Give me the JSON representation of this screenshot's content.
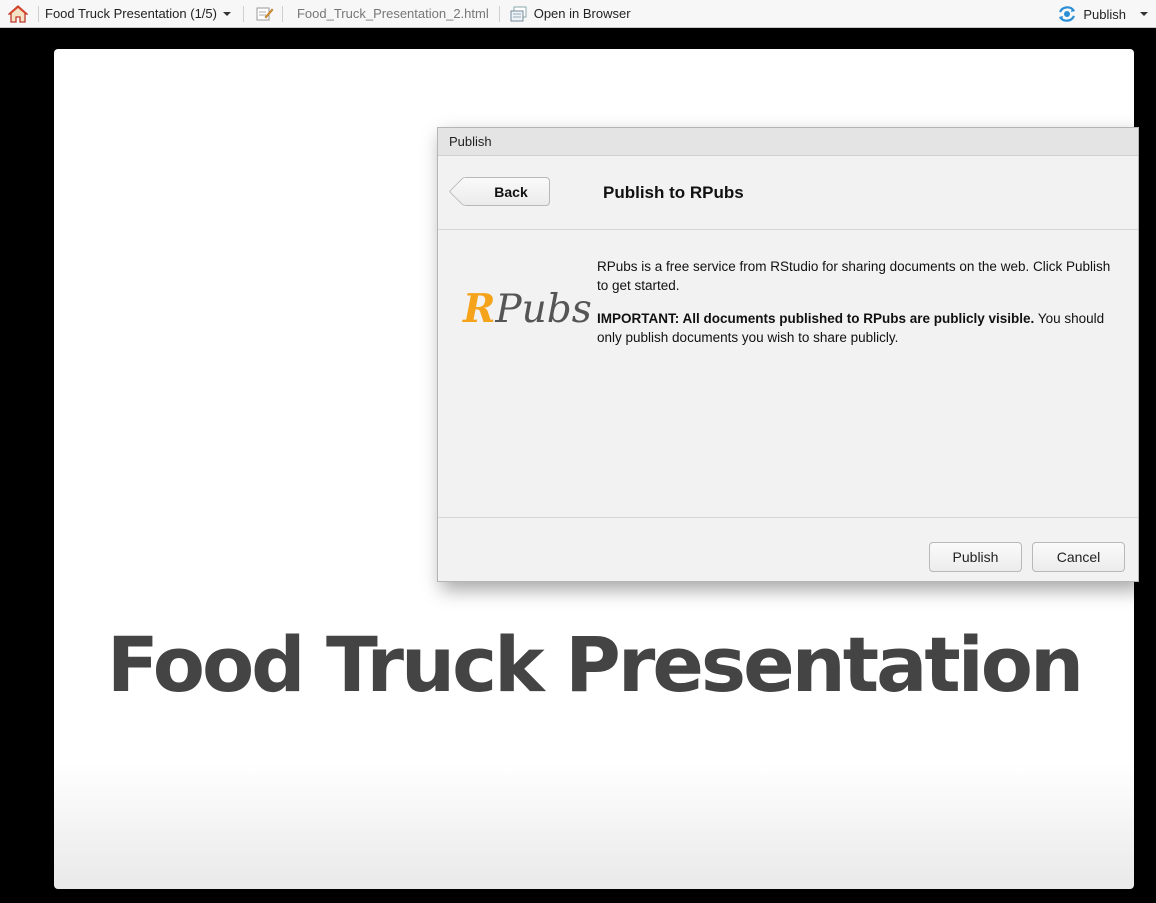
{
  "toolbar": {
    "presentation_label": "Food Truck Presentation (1/5)",
    "file_name": "Food_Truck_Presentation_2.html",
    "open_browser_label": "Open in Browser",
    "publish_label": "Publish"
  },
  "dialog": {
    "window_title": "Publish",
    "back_label": "Back",
    "heading": "Publish to RPubs",
    "logo_r": "R",
    "logo_rest": "Pubs",
    "paragraph1": "RPubs is a free service from RStudio for sharing documents on the web. Click Publish to get started.",
    "important_bold": "IMPORTANT: All documents published to RPubs are publicly visible.",
    "important_rest": " You should only publish documents you wish to share publicly.",
    "publish_button": "Publish",
    "cancel_button": "Cancel"
  },
  "slide": {
    "title": "Food Truck Presentation"
  },
  "colors": {
    "logo_accent": "#f5a31a",
    "publish_icon": "#2a8fd6",
    "home_roof": "#d9432a"
  }
}
